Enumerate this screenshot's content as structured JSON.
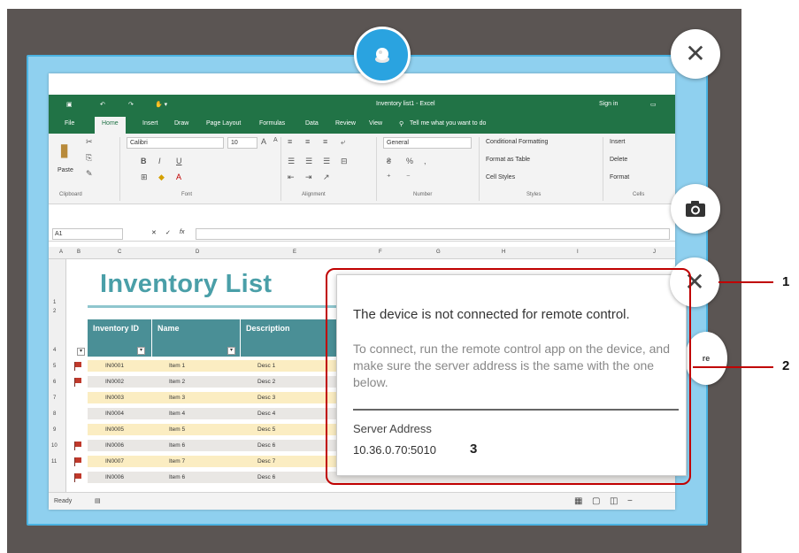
{
  "excel": {
    "title": "Inventory list1 - Excel",
    "sign_in": "Sign in",
    "tabs": [
      "File",
      "Home",
      "Insert",
      "Draw",
      "Page Layout",
      "Formulas",
      "Data",
      "Review",
      "View"
    ],
    "tell_me": "Tell me what you want to do",
    "ribbon": {
      "paste": "Paste",
      "clipboard": "Clipboard",
      "font_name": "Calibri",
      "font_size": "10",
      "font_group": "Font",
      "alignment_group": "Alignment",
      "number_format": "General",
      "number_group": "Number",
      "conditional_formatting": "Conditional Formatting",
      "format_as_table": "Format as Table",
      "cell_styles": "Cell Styles",
      "styles_group": "Styles",
      "insert": "Insert",
      "delete": "Delete",
      "format": "Format",
      "cells_group": "Cells"
    },
    "name_box": "A1",
    "columns": [
      "A",
      "B",
      "C",
      "D",
      "E",
      "F",
      "G",
      "H",
      "I",
      "J"
    ],
    "rows": [
      "1",
      "2",
      "4",
      "5",
      "6",
      "7",
      "8",
      "9",
      "10",
      "11"
    ],
    "sheet_title": "Inventory List",
    "headers": [
      "Inventory ID",
      "Name",
      "Description"
    ],
    "data": [
      {
        "id": "IN0001",
        "name": "Item 1",
        "desc": "Desc 1"
      },
      {
        "id": "IN0002",
        "name": "Item 2",
        "desc": "Desc 2"
      },
      {
        "id": "IN0003",
        "name": "Item 3",
        "desc": "Desc 3"
      },
      {
        "id": "IN0004",
        "name": "Item 4",
        "desc": "Desc 4"
      },
      {
        "id": "IN0005",
        "name": "Item 5",
        "desc": "Desc 5"
      },
      {
        "id": "IN0006",
        "name": "Item 6",
        "desc": "Desc 6"
      },
      {
        "id": "IN0007",
        "name": "Item 7",
        "desc": "Desc 7"
      },
      {
        "id": "IN0006",
        "name": "Item 6",
        "desc": "Desc 6"
      }
    ],
    "status": "Ready"
  },
  "popup": {
    "title": "The device is not connected for remote control.",
    "body": "To connect, run the remote control app on the device, and make sure the server address is the same with the one below.",
    "server_label": "Server Address",
    "server_value": "10.36.0.70:5010"
  },
  "side_button_partial": "re",
  "annotations": {
    "one": "1",
    "two": "2",
    "three": "3"
  },
  "colors": {
    "excel_green": "#217346",
    "frame_blue": "#8fd0ef",
    "teal": "#4a8f96",
    "callout_red": "#c00000"
  }
}
